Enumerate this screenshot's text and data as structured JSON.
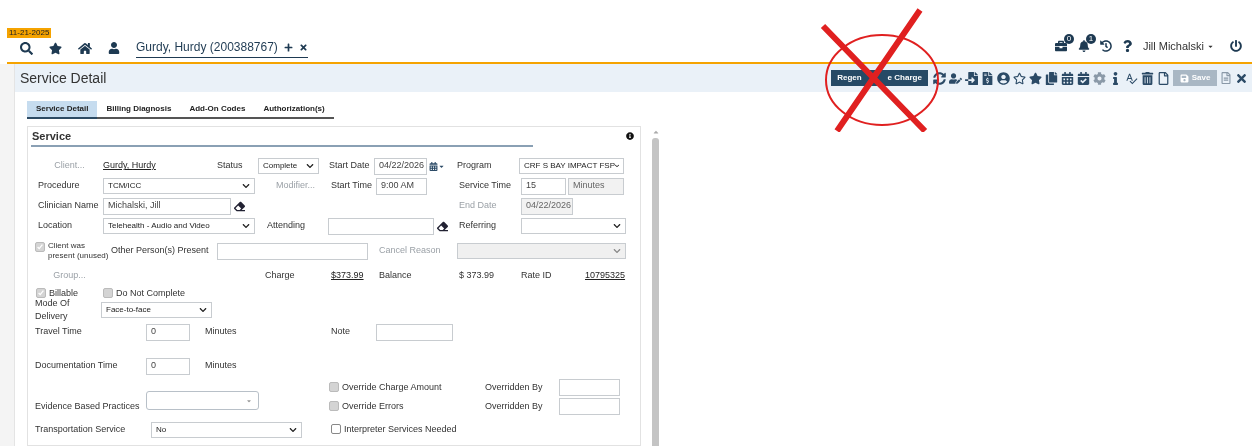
{
  "date_badge": "11-21-2025",
  "patient_tab": {
    "label": "Gurdy, Hurdy (200388767)"
  },
  "notifications": {
    "briefcase_count": "0",
    "bell_count": "1"
  },
  "user_menu": {
    "name": "Jill Michalski"
  },
  "page_title": "Service Detail",
  "toolbar": {
    "regenerate_button": {
      "visible_start": "Regen",
      "visible_end": "e Charge"
    },
    "save_button": {
      "label": "Save",
      "disabled": true
    }
  },
  "tabs": [
    {
      "label": "Service Detail",
      "selected": true
    },
    {
      "label": "Billing Diagnosis",
      "selected": false
    },
    {
      "label": "Add-On Codes",
      "selected": false
    },
    {
      "label": "Authorization(s)",
      "selected": false
    }
  ],
  "section_title": "Service",
  "fields": {
    "client": {
      "label": "Client...",
      "disabled": true,
      "value": "Gurdy, Hurdy"
    },
    "status": {
      "label": "Status",
      "value": "Complete"
    },
    "start_date": {
      "label": "Start Date",
      "value": "04/22/2026"
    },
    "program": {
      "label": "Program",
      "value": "CRF S BAY IMPACT FSP"
    },
    "procedure": {
      "label": "Procedure",
      "value": "TCM/ICC"
    },
    "modifier": {
      "label": "Modifier...",
      "disabled": true
    },
    "start_time": {
      "label": "Start Time",
      "value": "9:00 AM"
    },
    "service_time": {
      "label": "Service Time",
      "value": "15",
      "unit": "Minutes"
    },
    "clinician": {
      "label": "Clinician Name",
      "value": "Michalski, Jill"
    },
    "end_date": {
      "label": "End Date",
      "value": "04/22/2026",
      "disabled": true
    },
    "location": {
      "label": "Location",
      "value": "Telehealth - Audio and Video"
    },
    "attending": {
      "label": "Attending"
    },
    "referring": {
      "label": "Referring"
    },
    "client_present": {
      "label": "Client was present (unused)",
      "checked": true,
      "disabled": true
    },
    "other_persons": {
      "label": "Other Person(s) Present"
    },
    "cancel_reason": {
      "label": "Cancel Reason",
      "disabled": true
    },
    "group": {
      "label": "Group...",
      "disabled": true
    },
    "charge": {
      "label": "Charge",
      "value": "$373.99"
    },
    "balance": {
      "label": "Balance",
      "value": "$ 373.99"
    },
    "rate_id": {
      "label": "Rate ID",
      "value": "10795325"
    },
    "billable": {
      "label": "Billable",
      "checked": true,
      "disabled": true
    },
    "do_not_complete": {
      "label": "Do Not Complete",
      "checked": false,
      "disabled": true
    },
    "mode_of_delivery": {
      "label": "Mode Of Delivery",
      "value": "Face-to-face"
    },
    "travel_time": {
      "label": "Travel Time",
      "value": "0",
      "unit": "Minutes"
    },
    "note": {
      "label": "Note"
    },
    "documentation_time": {
      "label": "Documentation Time",
      "value": "0",
      "unit": "Minutes"
    },
    "override_charge": {
      "label": "Override Charge Amount",
      "checked": false,
      "disabled": true
    },
    "overridden_by_charge": {
      "label": "Overridden By"
    },
    "evidence": {
      "label": "Evidence Based Practices"
    },
    "override_errors": {
      "label": "Override Errors",
      "checked": false,
      "disabled": true
    },
    "overridden_by_errors": {
      "label": "Overridden By"
    },
    "transportation": {
      "label": "Transportation Service",
      "value": "No"
    },
    "interpreter": {
      "label": "Interpreter Services Needed",
      "checked": false,
      "disabled": false
    }
  }
}
